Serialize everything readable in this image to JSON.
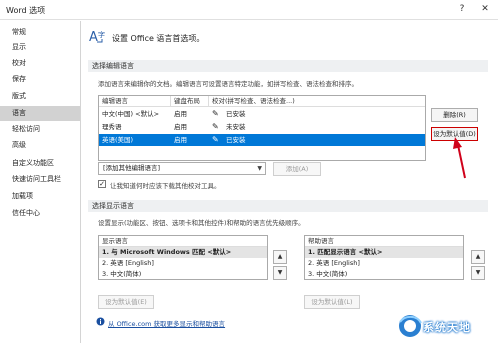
{
  "window": {
    "title": "Word 选项",
    "help_glyph": "?",
    "close_glyph": "✕"
  },
  "sidebar": {
    "items": [
      {
        "label": "常规",
        "active": false
      },
      {
        "label": "显示",
        "active": false
      },
      {
        "label": "校对",
        "active": false
      },
      {
        "label": "保存",
        "active": false
      },
      {
        "label": "版式",
        "active": false
      },
      {
        "label": "语言",
        "active": true
      },
      {
        "label": "轻松访问",
        "active": false
      },
      {
        "label": "高级",
        "active": false
      },
      {
        "label": "自定义功能区",
        "active": false
      },
      {
        "label": "快速访问工具栏",
        "active": false
      },
      {
        "label": "加载项",
        "active": false
      },
      {
        "label": "信任中心",
        "active": false
      }
    ]
  },
  "header": {
    "text": "设置 Office 语言首选项。",
    "icon": "language-icon"
  },
  "editing": {
    "section_title": "选择编辑语言",
    "description": "添加语言来编辑你的文档。编辑语言可设置语言特定功能，如拼写检查、语法检查和排序。",
    "columns": [
      "编辑语言",
      "键盘布局",
      "校对(拼写检查、语法检查...)"
    ],
    "rows": [
      {
        "language": "中文(中国) <默认>",
        "keyboard": "启用",
        "proofing": "已安装",
        "selected": false
      },
      {
        "language": "理秀语",
        "keyboard": "启用",
        "proofing": "未安装",
        "selected": false
      },
      {
        "language": "英语(美国)",
        "keyboard": "启用",
        "proofing": "已安装",
        "selected": true
      }
    ],
    "remove_button": "删除(R)",
    "set_default_button": "设为默认值(D)",
    "add_select_value": "[添加其他编辑语言]",
    "add_button": "添加(A)",
    "notify_checkbox_label": "让我知道何时应该下载其他校对工具。",
    "notify_checked": true
  },
  "display": {
    "section_title": "选择显示语言",
    "description": "设置显示(功能区、按钮、选项卡和其他控件)和帮助的语言优先级顺序。",
    "display_list": {
      "header": "显示语言",
      "items": [
        {
          "text": "1.     与 Microsoft Windows 匹配 <默认>",
          "selected": true
        },
        {
          "text": "2.     英语 [English]",
          "selected": false
        },
        {
          "text": "3.     中文(简体)",
          "selected": false
        }
      ],
      "set_default_button": "设为默认值(E)"
    },
    "help_list": {
      "header": "帮助语言",
      "items": [
        {
          "text": "1.     匹配显示语言 <默认>",
          "selected": true
        },
        {
          "text": "2.     英语 [English]",
          "selected": false
        },
        {
          "text": "3.     中文(简体)",
          "selected": false
        }
      ],
      "set_default_button": "设为默认值(L)"
    },
    "office_link": "从 Office.com 获取更多显示和帮助语言",
    "spin_up_glyph": "▲",
    "spin_down_glyph": "▼"
  },
  "annotation_color": "#d0021b",
  "watermark": {
    "text": "系统天地",
    "color": "#2a7fd1"
  }
}
